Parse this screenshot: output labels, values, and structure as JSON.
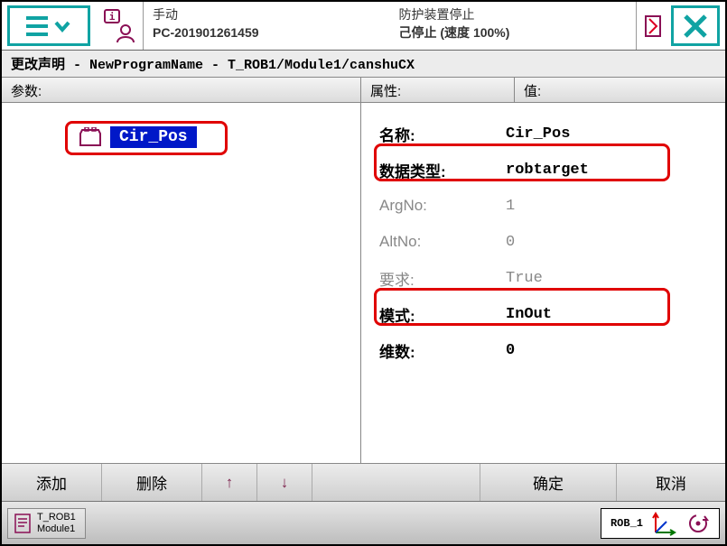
{
  "sysbar": {
    "status1_row1": "手动",
    "status1_row2": "PC-201901261459",
    "status2_row1": "防护装置停止",
    "status2_row2": "己停止 (速度 100%)"
  },
  "breadcrumb": "更改声明 - NewProgramName - T_ROB1/Module1/canshuCX",
  "headers": {
    "left": "参数:",
    "mid": "属性:",
    "right": "值:"
  },
  "param": {
    "name": "Cir_Pos"
  },
  "attrs": [
    {
      "label": "名称:",
      "value": "Cir_Pos",
      "bold": true,
      "dim": false
    },
    {
      "label": "数据类型:",
      "value": "robtarget",
      "bold": true,
      "dim": false
    },
    {
      "label": "ArgNo:",
      "value": "1",
      "bold": false,
      "dim": true
    },
    {
      "label": "AltNo:",
      "value": "0",
      "bold": false,
      "dim": true
    },
    {
      "label": "要求:",
      "value": "True",
      "bold": false,
      "dim": true
    },
    {
      "label": "模式:",
      "value": "InOut",
      "bold": true,
      "dim": false
    },
    {
      "label": "维数:",
      "value": "0",
      "bold": true,
      "dim": false
    }
  ],
  "btnbar": {
    "add": "添加",
    "del": "删除",
    "up": "↑",
    "down": "↓",
    "ok": "确定",
    "cancel": "取消"
  },
  "taskbar": {
    "task_line1": "T_ROB1",
    "task_line2": "Module1",
    "rob_label": "ROB_1"
  }
}
